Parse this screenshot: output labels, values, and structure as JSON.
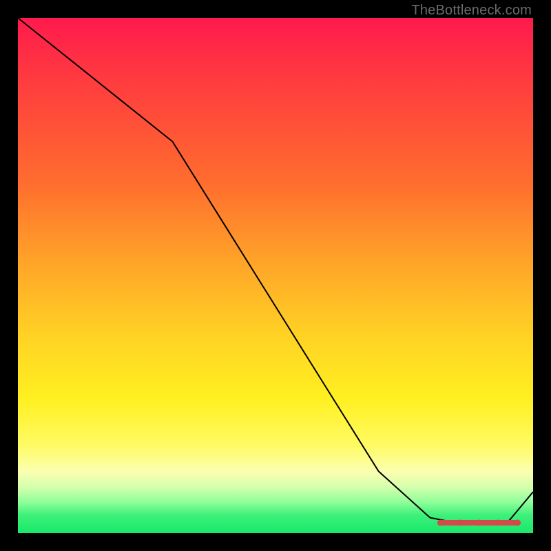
{
  "watermark": "TheBottleneck.com",
  "colors": {
    "gradient_top": "#ff1a4d",
    "gradient_mid": "#ffd324",
    "gradient_bottom": "#18e86b",
    "line": "#000000",
    "marker": "#d24a4a",
    "frame": "#000000"
  },
  "chart_data": {
    "type": "line",
    "title": "",
    "xlabel": "",
    "ylabel": "",
    "xlim": [
      0,
      100
    ],
    "ylim": [
      0,
      100
    ],
    "x": [
      0,
      10,
      20,
      30,
      40,
      50,
      60,
      70,
      80,
      85,
      90,
      95,
      100
    ],
    "values": [
      100,
      92,
      84,
      76,
      60,
      44,
      28,
      12,
      3,
      2,
      2,
      2,
      8
    ],
    "highlight_range": {
      "x_start": 82,
      "x_end": 97,
      "y": 2
    },
    "note": "Values are read off the gradient-band position; no numeric axes are printed so readings are approximate."
  }
}
